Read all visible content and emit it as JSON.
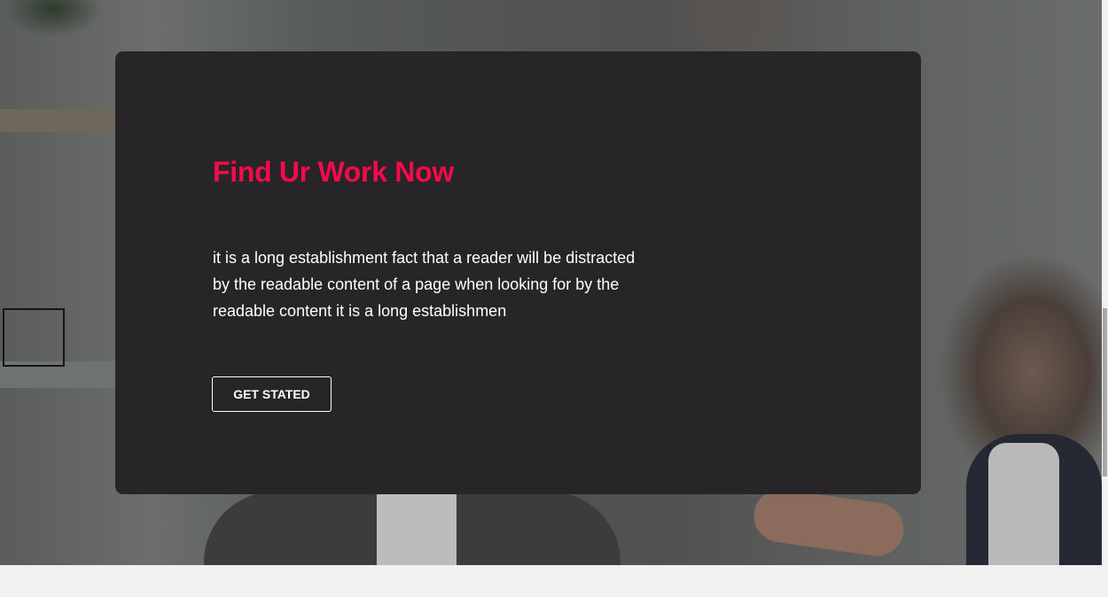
{
  "hero": {
    "title": "Find Ur Work Now",
    "description": "it is a long establishment fact that a reader will be distracted by the readable content of a page when looking for by the readable content it is a long establishmen",
    "cta_label": "GET STATED"
  },
  "colors": {
    "accent": "#f50a4b",
    "card_background": "#272528",
    "text": "#ffffff"
  }
}
